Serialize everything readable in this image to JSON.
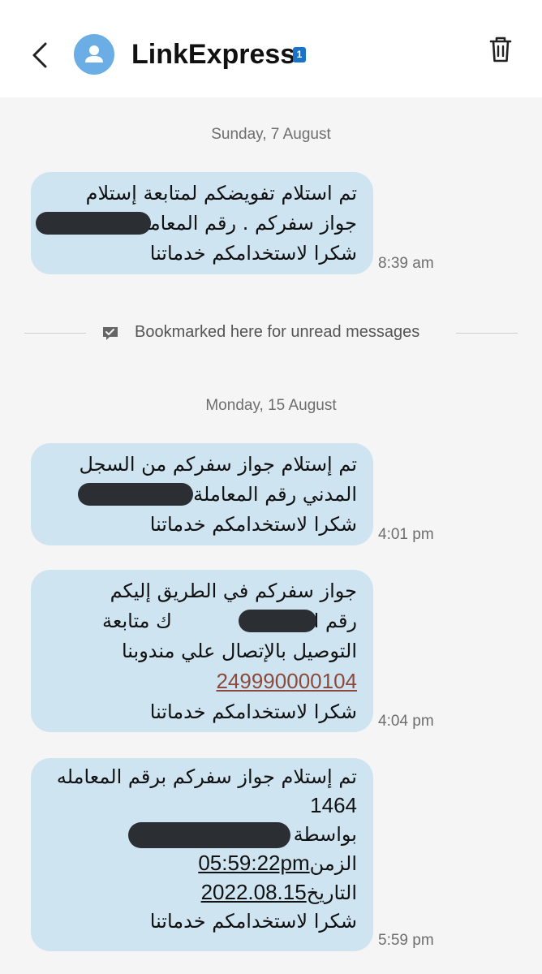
{
  "header": {
    "title": "LinkExpress",
    "sim_badge": "1"
  },
  "conversation": [
    {
      "date": "Sunday, 7 August",
      "messages": [
        {
          "time": "8:39 am",
          "lines": [
            "تم استلام تفويضكم لمتابعة إستلام",
            "جواز سفركم . رقم المعاملة",
            "شكرا لاستخدامكم خدماتنا"
          ]
        }
      ]
    },
    {
      "date": "Monday, 15 August",
      "messages": [
        {
          "time": "4:01 pm",
          "lines": [
            "تم إستلام جواز سفركم من السجل",
            "المدني رقم المعاملة",
            "شكرا لاستخدامكم خدماتنا"
          ]
        },
        {
          "time": "4:04 pm",
          "lines": [
            "جواز سفركم في الطريق إليكم",
            "رقم المعاملة",
            "ك متابعة",
            "التوصيل بالإتصال علي مندوبنا",
            "249990000104",
            "شكرا لاستخدامكم خدماتنا"
          ]
        },
        {
          "time": "5:59 pm",
          "lines": [
            "تم إستلام جواز سفركم برقم المعامله",
            "1464",
            "بواسطة",
            "الزمن",
            "05:59:22pm",
            "التاريخ",
            "2022.08.15",
            "شكرا لاستخدامكم خدماتنا"
          ]
        }
      ]
    }
  ],
  "bookmark": {
    "text": "Bookmarked here for unread messages"
  },
  "icons": {
    "back": "back-arrow-icon",
    "avatar": "person-icon",
    "delete": "trash-icon",
    "bookmark": "bookmark-message-icon"
  },
  "colors": {
    "bubble": "#cfe4f1",
    "avatar": "#6aaee5",
    "badge": "#1a73c9",
    "link": "#8b4a3c"
  }
}
